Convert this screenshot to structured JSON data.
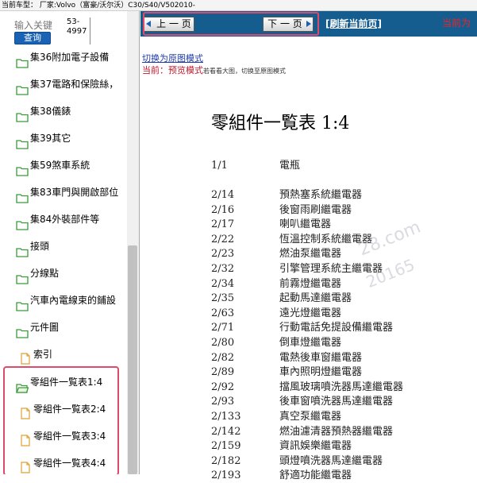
{
  "top": {
    "car_model": "当前车型： 厂家:Volvo（富豪/沃尔沃）C30/S40/V502010-"
  },
  "sidebar": {
    "search_placeholder": "输入关键",
    "query_button": "查询",
    "code_line1": "53-",
    "code_line2": "4997",
    "items": [
      {
        "label": "集36附加電子設備",
        "type": "folder"
      },
      {
        "label": "集37電路和保險絲，",
        "type": "folder"
      },
      {
        "label": "集38儀錶",
        "type": "folder"
      },
      {
        "label": "集39其它",
        "type": "folder"
      },
      {
        "label": "集59煞車系統",
        "type": "folder"
      },
      {
        "label": "集83車門與開啟部位",
        "type": "folder"
      },
      {
        "label": "集84外裝部件等",
        "type": "folder"
      },
      {
        "label": "接頭",
        "type": "folder"
      },
      {
        "label": "分線點",
        "type": "folder"
      },
      {
        "label": "汽車內電線束的鋪設",
        "type": "folder"
      },
      {
        "label": "元件圖",
        "type": "folder"
      },
      {
        "label": "索引",
        "type": "doc"
      },
      {
        "label": "零組件一覧表1:4",
        "type": "folder-open"
      },
      {
        "label": "零組件一覧表2:4",
        "type": "doc"
      },
      {
        "label": "零組件一覧表3:4",
        "type": "doc"
      },
      {
        "label": "零組件一覧表4:4",
        "type": "doc"
      }
    ]
  },
  "nav": {
    "prev_label": "上 一 页",
    "next_label": "下 一 页",
    "refresh_label": "[刷新当前页]",
    "current_label": "当前为"
  },
  "mode": {
    "switch_link": "切换为原图模式",
    "current_prefix": "当前：",
    "current_mode": "预览模式",
    "hint": "若看看大图，切换至原图模式"
  },
  "document": {
    "title": "零組件一覧表 1:4",
    "entries": [
      {
        "code": "1/1",
        "name": "電瓶"
      },
      {
        "code": "2/14",
        "name": "預熱塞系統繼電器"
      },
      {
        "code": "2/16",
        "name": "後窗雨刷繼電器"
      },
      {
        "code": "2/17",
        "name": "喇叭繼電器"
      },
      {
        "code": "2/22",
        "name": "恆溫控制系統繼電器"
      },
      {
        "code": "2/23",
        "name": "燃油泵繼電器"
      },
      {
        "code": "2/32",
        "name": "引擎管理系統主繼電器"
      },
      {
        "code": "2/34",
        "name": "前霧燈繼電器"
      },
      {
        "code": "2/35",
        "name": "起動馬達繼電器"
      },
      {
        "code": "2/63",
        "name": "遠光燈繼電器"
      },
      {
        "code": "2/71",
        "name": "行動電話免提設備繼電器"
      },
      {
        "code": "2/80",
        "name": "倒車燈繼電器"
      },
      {
        "code": "2/82",
        "name": "電熱後車窗繼電器"
      },
      {
        "code": "2/89",
        "name": "車內照明燈繼電器"
      },
      {
        "code": "2/92",
        "name": "擋風玻璃噴洗器馬達繼電器"
      },
      {
        "code": "2/93",
        "name": "後車窗噴洗器馬達繼電器"
      },
      {
        "code": "2/133",
        "name": "真空泵繼電器"
      },
      {
        "code": "2/142",
        "name": "燃油濾清器預熱器繼電器"
      },
      {
        "code": "2/159",
        "name": "資訊娛樂繼電器"
      },
      {
        "code": "2/182",
        "name": "頭燈噴洗器馬達繼電器"
      },
      {
        "code": "2/193",
        "name": "舒適功能繼電器"
      }
    ],
    "watermark1": "28.com",
    "watermark2": "20165"
  },
  "colors": {
    "nav_bar": "#155d8f",
    "highlight": "#e04a6a",
    "mode_red": "#c0182a",
    "link_blue": "#1e3aa8"
  }
}
